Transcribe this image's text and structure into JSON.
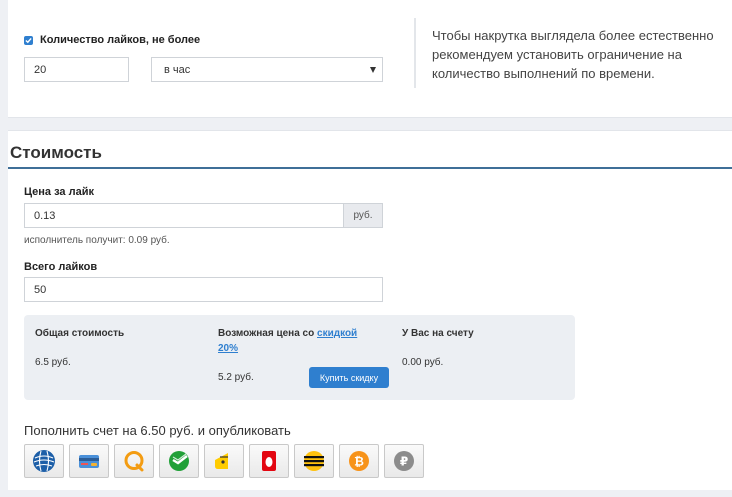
{
  "limit": {
    "checkbox_label": "Количество лайков, не более",
    "count_value": "20",
    "period_selected": "в час",
    "hint": "Чтобы накрутка выглядела более естественно рекомендуем установить ограничение на количество выполнений по времени."
  },
  "cost": {
    "section_title": "Стоимость",
    "price_label": "Цена за лайк",
    "price_value": "0.13",
    "currency_addon": "руб.",
    "executor_note": "исполнитель получит: 0.09 руб.",
    "total_likes_label": "Всего лайков",
    "total_likes_value": "50"
  },
  "totals": {
    "total_label": "Общая стоимость",
    "total_value": "6.5 руб.",
    "discount_label_prefix": "Возможная цена со ",
    "discount_link": "скидкой 20%",
    "discount_value": "5.2 руб.",
    "discount_button": "Купить скидку",
    "balance_label": "У Вас на счету",
    "balance_value": "0.00 руб."
  },
  "payment": {
    "title": "Пополнить счет на 6.50 руб. и опубликовать",
    "methods": [
      "webmoney-icon",
      "bank-card-icon",
      "qiwi-icon",
      "sberbank-icon",
      "yandex-money-icon",
      "mts-icon",
      "beeline-icon",
      "bitcoin-icon",
      "ruble-icon"
    ]
  },
  "colors": {
    "accent": "#2f7fcf",
    "section_rule": "#3f6f98"
  }
}
